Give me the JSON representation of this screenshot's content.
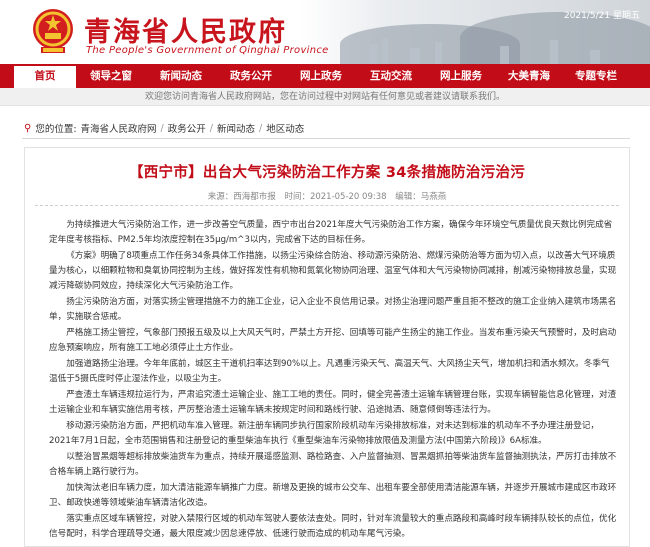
{
  "header": {
    "title": "青海省人民政府",
    "subtitle": "The People's Government of Qinghai Province",
    "date": "2021/5/21 星期五"
  },
  "nav": {
    "items": [
      {
        "label": "首页",
        "active": true
      },
      {
        "label": "领导之窗"
      },
      {
        "label": "新闻动态"
      },
      {
        "label": "政务公开"
      },
      {
        "label": "网上政务"
      },
      {
        "label": "互动交流"
      },
      {
        "label": "网上服务"
      },
      {
        "label": "大美青海"
      },
      {
        "label": "专题专栏"
      }
    ]
  },
  "welcome": "欢迎您访问青海省人民政府网站，您在访问过程中对网站有任何意见或者建议请联系我们。",
  "breadcrumb": {
    "label": "您的位置:",
    "items": [
      "青海省人民政府网",
      "政务公开",
      "新闻动态",
      "地区动态"
    ]
  },
  "article": {
    "title": "【西宁市】出台大气污染防治工作方案 34条措施防治污治污",
    "meta": {
      "source": "来源：西海都市报",
      "time": "时间：2021-05-20 09:38",
      "author": "编辑：马燕燕"
    },
    "paragraphs": [
      "为持续推进大气污染防治工作，进一步改善空气质量，西宁市出台2021年度大气污染防治工作方案，确保今年环境空气质量优良天数比例完成省定年度考核指标、PM2.5年均浓度控制在35μg/m^3以内，完成省下达的目标任务。",
      "《方案》明确了8项重点工作任务34条具体工作措施，以扬尘污染综合防治、移动源污染防治、燃煤污染防治等方面为切入点，以改善大气环境质量为核心，以细颗粒物和臭氧协同控制为主线，做好挥发性有机物和氮氧化物协同治理、温室气体和大气污染物协同减排，削减污染物排放总量，实现减污降碳协同效应，持续深化大气污染防治工作。",
      "扬尘污染防治方面，对落实扬尘管理措施不力的施工企业，记入企业不良信用记录。对扬尘治理问题严重且拒不整改的施工企业纳入建筑市场黑名单，实施联合惩戒。",
      "严格施工扬尘管控，气象部门预报五级及以上大风天气时，严禁土方开挖、回填等可能产生扬尘的施工作业。当发布重污染天气预警时，及时启动应急预案响应，所有施工工地必须停止土方作业。",
      "加强道路扬尘治理。今年年底前，城区主干道机扫率达到90%以上。凡遇重污染天气、高温天气、大风扬尘天气，增加机扫和洒水频次。冬季气温低于5摄氏度时停止湿法作业，以吸尘为主。",
      "严查渣土车辆违规拉运行为，严肃追究渣土运输企业、施工工地的责任。同时，健全完善渣土运输车辆管理台账，实现车辆智能信息化管理，对渣土运输企业和车辆实施信用考核，严厉整治渣土运输车辆未按规定时间和路线行驶、沿途抛洒、随意倾倒等违法行为。",
      "移动源污染防治方面，严把机动车准入管理。新注册车辆同步执行国家阶段机动车污染排放标准，对未达到标准的机动车不予办理注册登记，2021年7月1日起，全市范围销售和注册登记的重型柴油车执行《重型柴油车污染物排放限值及测量方法(中国第六阶段)》6A标准。",
      "以整治冒黑烟等超标排放柴油货车为重点，持续开展遥感监测、路检路查、入户监督抽测、冒黑烟抓拍等柴油货车监督抽测执法，严厉打击排放不合格车辆上路行驶行为。",
      "加快淘汰老旧车辆力度，加大清洁能源车辆推广力度。新增及更换的城市公交车、出租车要全部使用清洁能源车辆，并逐步开展城市建成区市政环卫、邮政快递等领域柴油车辆清洁化改造。",
      "落实重点区域车辆管控，对驶入禁限行区域的机动车驾驶人要依法查处。同时，针对车流量较大的重点路段和高峰时段车辆排队较长的点位，优化信号配时，科学合理疏导交通，最大限度减少因怠速停放、低速行驶而造成的机动车尾气污染。"
    ]
  },
  "colors": {
    "brand_red": "#c20d19",
    "title_red": "#c8151d"
  }
}
